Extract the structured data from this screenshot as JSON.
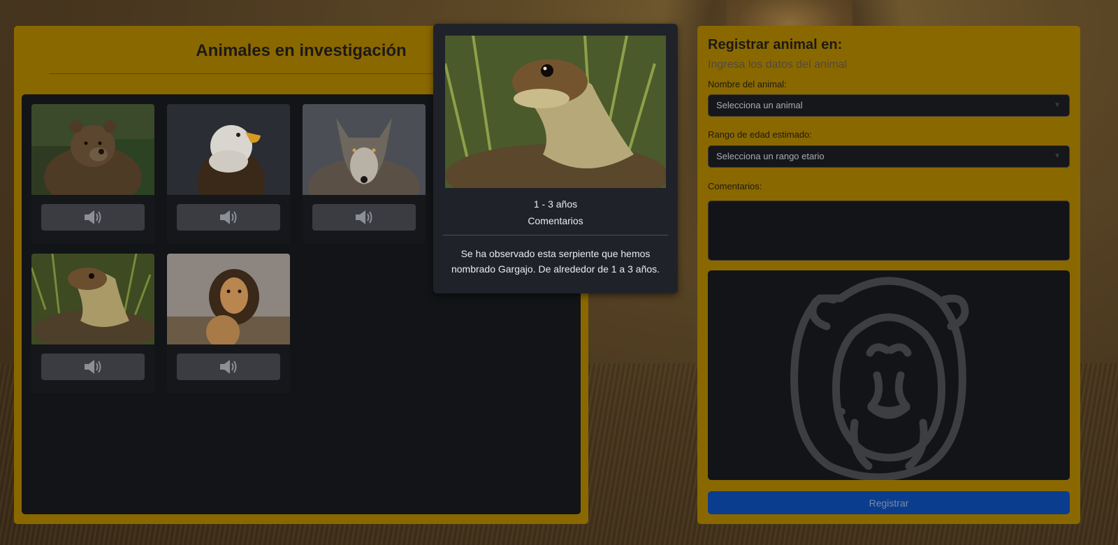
{
  "gallery": {
    "title": "Animales en investigación",
    "cards": [
      {
        "animal": "bear",
        "sound_icon": "speaker-icon"
      },
      {
        "animal": "eagle",
        "sound_icon": "speaker-icon"
      },
      {
        "animal": "wolf",
        "sound_icon": "speaker-icon"
      },
      {
        "animal": "snake",
        "sound_icon": "speaker-icon"
      },
      {
        "animal": "lion",
        "sound_icon": "speaker-icon"
      }
    ]
  },
  "popover": {
    "age": "1 - 3 años",
    "comments_label": "Comentarios",
    "comment_text": "Se ha observado esta serpiente que hemos nombrado Gargajo. De alrededor de 1 a 3 años."
  },
  "form": {
    "title": "Registrar animal en:",
    "subtitle": "Ingresa los datos del animal",
    "name_label": "Nombre del animal:",
    "name_placeholder": "Selecciona un animal",
    "age_label": "Rango de edad estimado:",
    "age_placeholder": "Selecciona un rango etario",
    "comments_label": "Comentarios:",
    "comments_value": "",
    "preview_icon": "lion-outline-icon",
    "submit_label": "Registrar"
  },
  "colors": {
    "panel": "#8a6800",
    "dark": "#121417",
    "button_primary": "#0b3d8f"
  }
}
